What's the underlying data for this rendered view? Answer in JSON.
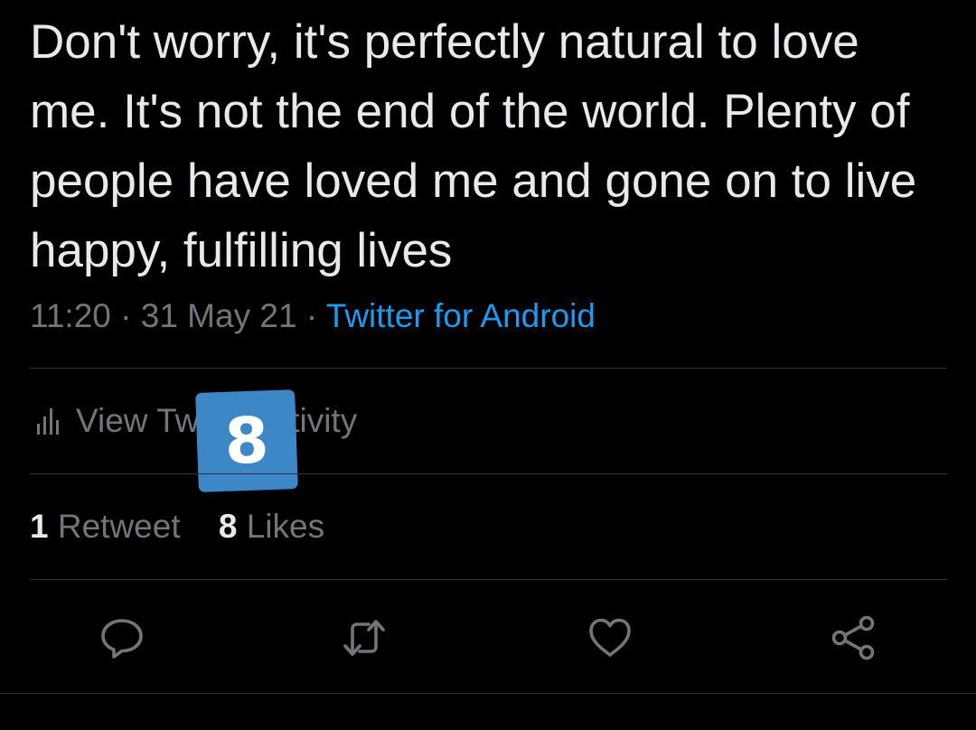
{
  "tweet": {
    "text": "Don't worry, it's perfectly natural to love me. It's not the end of the world. Plenty of people have loved me and gone on to live happy, fulfilling lives",
    "time": "11:20",
    "date": "31 May 21",
    "separator": "·",
    "source": "Twitter for Android"
  },
  "activity": {
    "label": "View Tweet activity",
    "icon": "bar-chart-icon"
  },
  "badge": {
    "value": "8"
  },
  "stats": {
    "retweet_count": "1",
    "retweet_label": "Retweet",
    "likes_count": "8",
    "likes_label": "Likes"
  },
  "actions": [
    {
      "name": "reply",
      "icon": "reply-icon"
    },
    {
      "name": "retweet",
      "icon": "retweet-icon"
    },
    {
      "name": "like",
      "icon": "heart-icon"
    },
    {
      "name": "share",
      "icon": "share-icon"
    }
  ],
  "colors": {
    "background": "#000000",
    "text": "#e7e9ea",
    "secondary": "#71767b",
    "link": "#1d9bf0",
    "divider": "#2f3336",
    "badge": "#3d87c7"
  }
}
